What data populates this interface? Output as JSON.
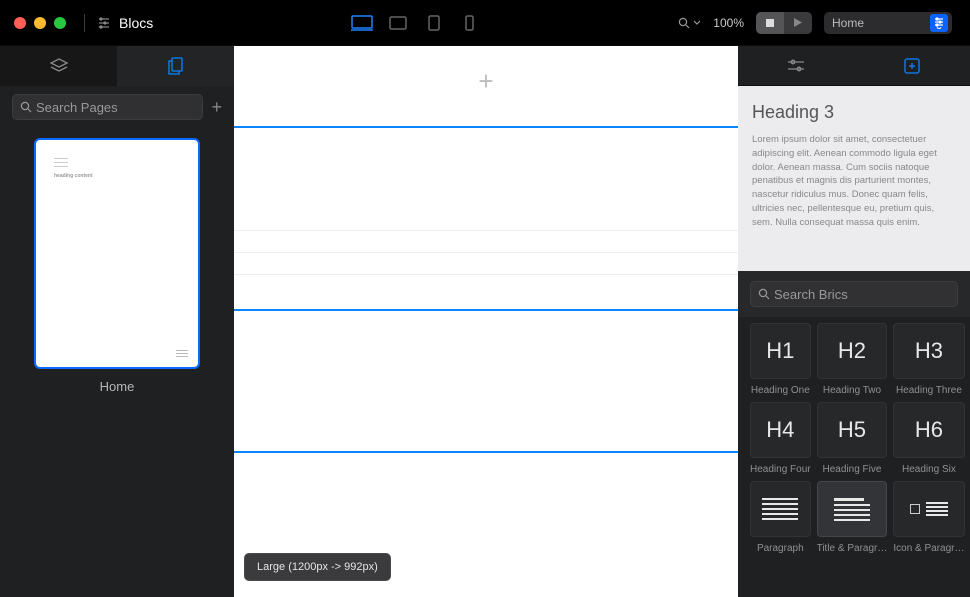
{
  "app": {
    "name": "Blocs"
  },
  "toolbar": {
    "zoom": "100%",
    "page_selected": "Home"
  },
  "left_panel": {
    "search_placeholder": "Search Pages",
    "thumb_heading": "heading content",
    "thumb_label": "Home"
  },
  "canvas": {
    "tooltip": "Large (1200px -> 992px)"
  },
  "right_panel": {
    "preview_heading": "Heading 3",
    "preview_text": "Lorem ipsum dolor sit amet, consectetuer adipiscing elit. Aenean commodo ligula eget dolor. Aenean massa. Cum sociis natoque penatibus et magnis dis parturient montes, nascetur ridiculus mus. Donec quam felis, ultricies nec, pellentesque eu, pretium quis, sem. Nulla consequat massa quis enim.",
    "search_placeholder": "Search Brics",
    "brics": [
      {
        "glyph": "H1",
        "label": "Heading One"
      },
      {
        "glyph": "H2",
        "label": "Heading Two"
      },
      {
        "glyph": "H3",
        "label": "Heading Three"
      },
      {
        "glyph": "H4",
        "label": "Heading Four"
      },
      {
        "glyph": "H5",
        "label": "Heading Five"
      },
      {
        "glyph": "H6",
        "label": "Heading Six"
      },
      {
        "glyph": "para",
        "label": "Paragraph"
      },
      {
        "glyph": "tp",
        "label": "Title & Paragr…"
      },
      {
        "glyph": "ip",
        "label": "Icon & Paragr…"
      }
    ]
  }
}
